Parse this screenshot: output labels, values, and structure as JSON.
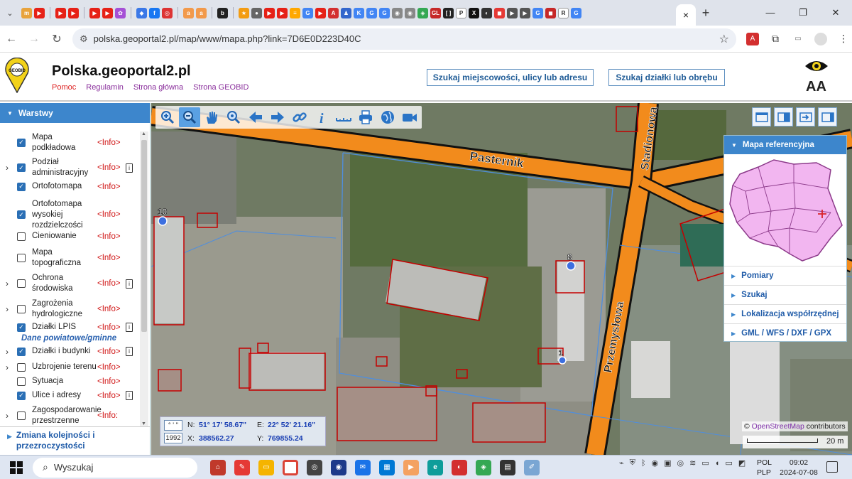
{
  "browser": {
    "tab_strip_menu_icon": "chevron-down-icon",
    "active_tab_close": "×",
    "new_tab": "+",
    "window_minimize": "—",
    "window_restore": "❐",
    "window_close": "✕",
    "url": "polska.geoportal2.pl/map/www/mapa.php?link=7D6E0D223D40C"
  },
  "header": {
    "title": "Polska.geoportal2.pl",
    "logo_text": "GEOBID",
    "links": [
      "Pomoc",
      "Regulamin",
      "Strona główna",
      "Strona GEOBID"
    ],
    "search_place_button": "Szukaj miejscowości, ulicy lub adresu",
    "search_parcel_button": "Szukaj działki lub obrębu",
    "font_size_label": "AA"
  },
  "sidebar": {
    "title": "Warstwy",
    "layers": [
      {
        "name": "Mapa podkładowa",
        "info": "<Info>",
        "checked": true,
        "expandable": false,
        "doc": false
      },
      {
        "name": "Podział administracyjny",
        "info": "<Info>",
        "checked": true,
        "expandable": true,
        "doc": true
      },
      {
        "name": "Ortofotomapa",
        "info": "<Info>",
        "checked": true,
        "expandable": false,
        "doc": false
      },
      {
        "name": "Ortofotomapa wysokiej rozdzielczości",
        "info": "<Info>",
        "checked": true,
        "expandable": false,
        "doc": false
      },
      {
        "name": "Cieniowanie",
        "info": "<Info>",
        "checked": false,
        "expandable": false,
        "doc": false
      },
      {
        "name": "Mapa topograficzna",
        "info": "<Info>",
        "checked": false,
        "expandable": false,
        "doc": false
      },
      {
        "name": "Ochrona środowiska",
        "info": "<Info>",
        "checked": false,
        "expandable": true,
        "doc": true
      },
      {
        "name": "Zagrożenia hydrologiczne",
        "info": "<Info>",
        "checked": false,
        "expandable": true,
        "doc": false
      },
      {
        "name": "Działki LPIS",
        "info": "<Info>",
        "checked": true,
        "expandable": false,
        "doc": true
      }
    ],
    "section_label": "Dane powiatowe/gminne",
    "county_layers": [
      {
        "name": "Działki i budynki",
        "info": "<Info>",
        "checked": true,
        "expandable": true,
        "doc": true
      },
      {
        "name": "Uzbrojenie terenu",
        "info": "<Info>",
        "checked": false,
        "expandable": true,
        "doc": false
      },
      {
        "name": "Sytuacja",
        "info": "<Info>",
        "checked": false,
        "expandable": false,
        "doc": false
      },
      {
        "name": "Ulice i adresy",
        "info": "<Info>",
        "checked": true,
        "expandable": false,
        "doc": true
      },
      {
        "name": "Zagospodarowanie przestrzenne",
        "info": "<Info:",
        "checked": false,
        "expandable": true,
        "doc": false
      }
    ],
    "footer": "Zmiana kolejności i przezroczystości"
  },
  "map": {
    "street_labels": [
      "Pasternik",
      "Stadionowa",
      "Przemysłowa"
    ],
    "address_numbers": [
      "10",
      "8",
      "1"
    ],
    "reference_panel": {
      "title": "Mapa referencyjna",
      "links": [
        "Pomiary",
        "Szukaj",
        "Lokalizacja współrzędnej",
        "GML / WFS / DXF / GPX"
      ]
    },
    "coords": {
      "format_tag": "° ' \"",
      "system_tag": "1992",
      "n_label": "N:",
      "n_value": "51° 17' 58.67\"",
      "e_label": "E:",
      "e_value": "22° 52' 21.16\"",
      "x_label": "X:",
      "x_value": "388562.27",
      "y_label": "Y:",
      "y_value": "769855.24"
    },
    "attribution_prefix": "© ",
    "attribution_link": "OpenStreetMap",
    "attribution_suffix": " contributors",
    "scale_label": "20 m"
  },
  "taskbar": {
    "search_placeholder": "Wyszukaj",
    "lang_top": "POL",
    "lang_bottom": "PLP",
    "time": "09:02",
    "date": "2024-07-08"
  }
}
